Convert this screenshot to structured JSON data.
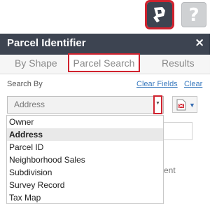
{
  "toolbar": {
    "parcel_tool_icon": "parcel-identifier-icon",
    "help_label": "?"
  },
  "panel": {
    "title": "Parcel Identifier",
    "close_label": "×"
  },
  "tabs": [
    {
      "label": "By Shape",
      "active": false
    },
    {
      "label": "Parcel Search",
      "active": true
    },
    {
      "label": "Results",
      "active": false
    }
  ],
  "search": {
    "search_by_label": "Search By",
    "clear_fields_label": "Clear Fields",
    "clear_label": "Clear",
    "selected_value": "Address",
    "options": [
      "Owner",
      "Address",
      "Parcel ID",
      "Neighborhood Sales",
      "Subdivision",
      "Survey Record",
      "Tax Map"
    ]
  },
  "background": {
    "partial_text": "ent"
  },
  "colors": {
    "header_bg": "#3d4451",
    "highlight": "#d0222e",
    "link": "#3b7bbf"
  }
}
